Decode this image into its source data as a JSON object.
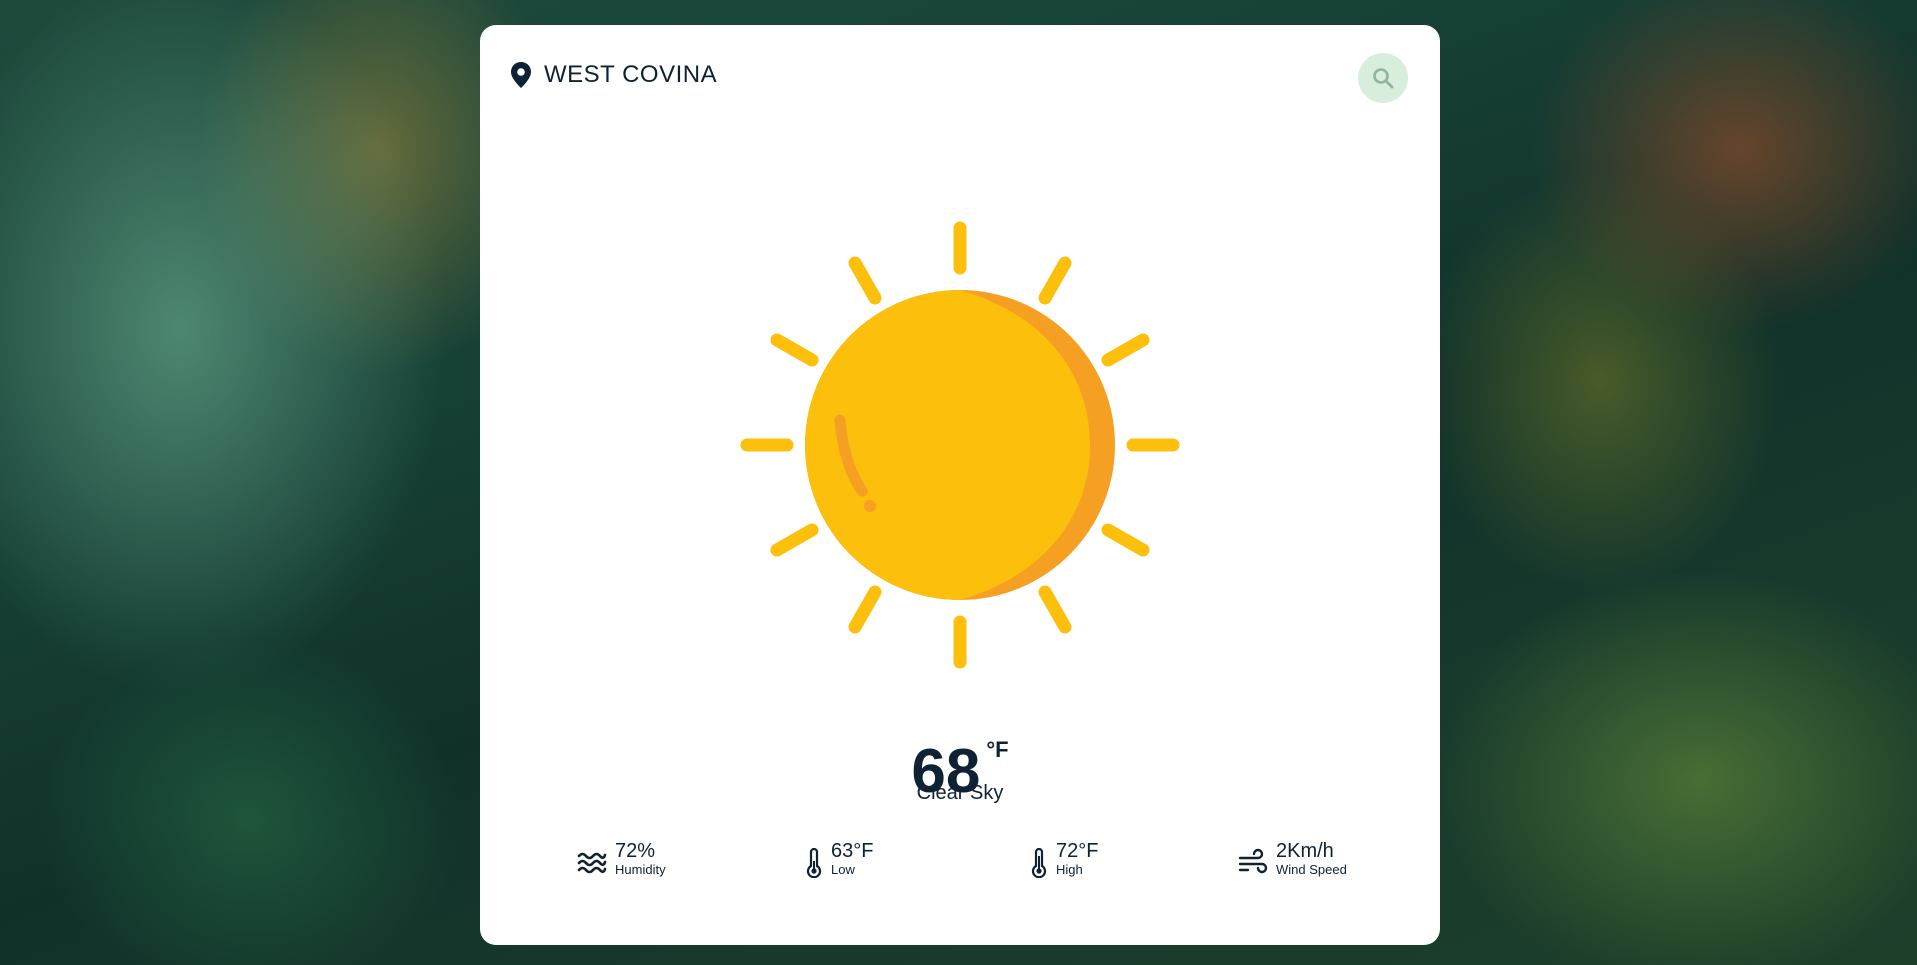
{
  "location": {
    "city": "WEST COVINA",
    "icon": "map-pin-icon"
  },
  "search": {
    "icon": "search-icon",
    "color": "#d7eedd"
  },
  "weather": {
    "icon": "sun-icon",
    "temperature": "68",
    "unit": "°F",
    "condition": "Clear Sky"
  },
  "stats": [
    {
      "value": "72%",
      "label": "Humidity",
      "icon": "humidity-waves-icon"
    },
    {
      "value": "63°F",
      "label": "Low",
      "icon": "thermometer-low-icon"
    },
    {
      "value": "72°F",
      "label": "High",
      "icon": "thermometer-high-icon"
    },
    {
      "value": "2Km/h",
      "label": "Wind Speed",
      "icon": "wind-icon"
    }
  ],
  "colors": {
    "text": "#0f2233",
    "sun": "#fbbf0c",
    "sun_shade": "#f6a023",
    "card": "#ffffff"
  }
}
